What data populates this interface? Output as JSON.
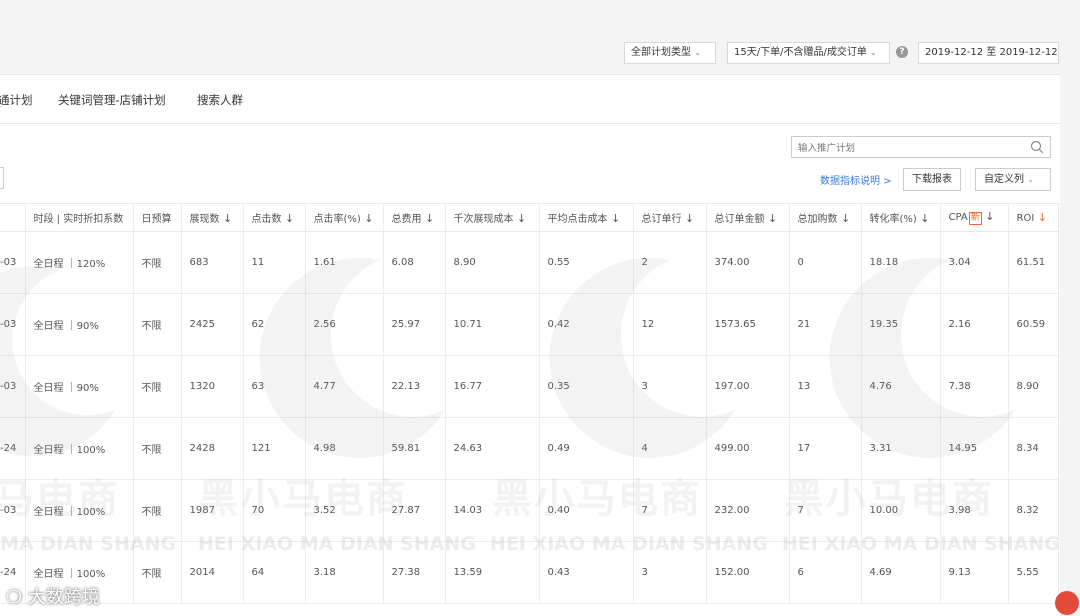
{
  "filters": {
    "plan_type": "全部计划类型",
    "order_metric": "15天/下单/不含赠品/成交订单",
    "help_icon": "?",
    "date_range": "2019-12-12 至 2019-12-12"
  },
  "tabs": [
    {
      "label": "通计划"
    },
    {
      "label": "关键词管理-店铺计划"
    },
    {
      "label": "搜索人群"
    }
  ],
  "search": {
    "placeholder": "输入推广计划"
  },
  "toolbar": {
    "metric_help": "数据指标说明 >",
    "download": "下载报表",
    "custom_columns": "自定义列"
  },
  "table": {
    "headers": [
      {
        "label": "",
        "sort": false
      },
      {
        "label": "时段 | 实时折扣系数",
        "sort": false
      },
      {
        "label": "日预算",
        "sort": false
      },
      {
        "label": "展现数",
        "sort": true
      },
      {
        "label": "点击数",
        "sort": true
      },
      {
        "label": "点击率(%)",
        "sort": true
      },
      {
        "label": "总费用",
        "sort": true
      },
      {
        "label": "千次展现成本",
        "sort": true
      },
      {
        "label": "平均点击成本",
        "sort": true
      },
      {
        "label": "总订单行",
        "sort": true
      },
      {
        "label": "总订单金额",
        "sort": true
      },
      {
        "label": "总加购数",
        "sort": true
      },
      {
        "label": "转化率(%)",
        "sort": true
      },
      {
        "label": "CPA",
        "sort": true,
        "badge": "新"
      },
      {
        "label": "ROI",
        "sort": true,
        "orange": true
      }
    ],
    "rows": [
      [
        "-03",
        "全日程 ｜120%",
        "不限",
        "683",
        "11",
        "1.61",
        "6.08",
        "8.90",
        "0.55",
        "2",
        "374.00",
        "0",
        "18.18",
        "3.04",
        "61.51"
      ],
      [
        "-03",
        "全日程 ｜90%",
        "不限",
        "2425",
        "62",
        "2.56",
        "25.97",
        "10.71",
        "0.42",
        "12",
        "1573.65",
        "21",
        "19.35",
        "2.16",
        "60.59"
      ],
      [
        "-03",
        "全日程 ｜90%",
        "不限",
        "1320",
        "63",
        "4.77",
        "22.13",
        "16.77",
        "0.35",
        "3",
        "197.00",
        "13",
        "4.76",
        "7.38",
        "8.90"
      ],
      [
        "-24",
        "全日程 ｜100%",
        "不限",
        "2428",
        "121",
        "4.98",
        "59.81",
        "24.63",
        "0.49",
        "4",
        "499.00",
        "17",
        "3.31",
        "14.95",
        "8.34"
      ],
      [
        "-03",
        "全日程 ｜100%",
        "不限",
        "1987",
        "70",
        "3.52",
        "27.87",
        "14.03",
        "0.40",
        "7",
        "232.00",
        "7",
        "10.00",
        "3.98",
        "8.32"
      ],
      [
        "-24",
        "全日程 ｜100%",
        "不限",
        "2014",
        "64",
        "3.18",
        "27.38",
        "13.59",
        "0.43",
        "3",
        "152.00",
        "6",
        "4.69",
        "9.13",
        "5.55"
      ]
    ]
  },
  "watermark": {
    "big": "黑小马电商",
    "small": "HEI XIAO MA DIAN SHANG",
    "left_big": "马电商",
    "left_small": "MA DIAN SHANG"
  },
  "bottom_logo": "大数跨境",
  "colors": {
    "link": "#2f6fc4",
    "accent": "#f0662a"
  }
}
